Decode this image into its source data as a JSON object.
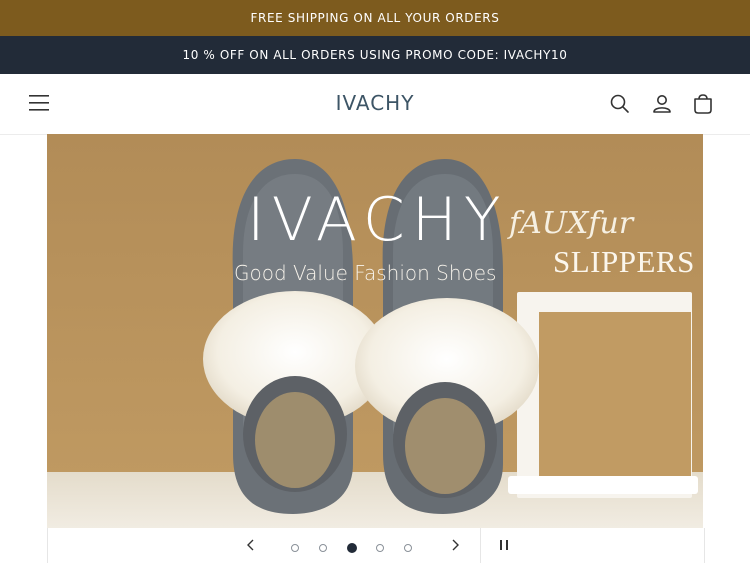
{
  "announcements": {
    "shipping": "FREE SHIPPING ON ALL YOUR ORDERS",
    "promo": "10 % OFF ON ALL ORDERS USING PROMO CODE: IVACHY10"
  },
  "header": {
    "logo": "IVACHY",
    "icons": [
      "menu-icon",
      "search-icon",
      "account-icon",
      "cart-icon"
    ]
  },
  "slideshow": {
    "slide": {
      "title": "IVACHY",
      "subtitle": "Good Value Fashion Shoes",
      "script_text": "fAUXfur",
      "product_text": "SLIPPERS"
    },
    "dots_total": 5,
    "active_dot": 3,
    "controls": [
      "chevron-left-icon",
      "chevron-right-icon",
      "pause-icon"
    ]
  },
  "colors": {
    "announcement_bar": "#7d5b1e",
    "promo_bar": "#222b38",
    "hero_background": "#b38c55"
  }
}
